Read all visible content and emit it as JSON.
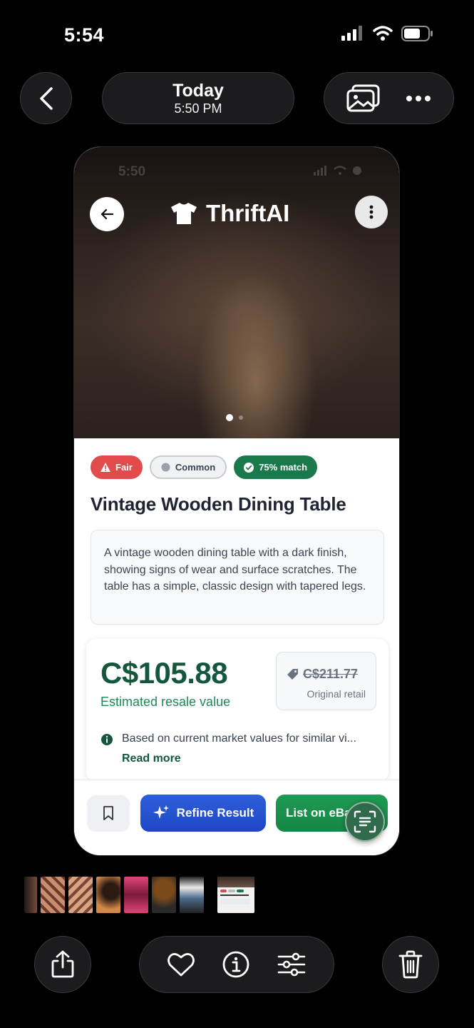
{
  "status_bar": {
    "time": "5:54"
  },
  "photos_header": {
    "date_title": "Today",
    "date_time": "5:50 PM"
  },
  "screenshot": {
    "status_time": "5:50",
    "app_name": "ThriftAI",
    "badges": {
      "condition": "Fair",
      "rarity": "Common",
      "match": "75% match"
    },
    "item_title": "Vintage Wooden Dining Table",
    "description": "A vintage wooden dining table with a dark finish, showing signs of wear and surface scratches. The table has a simple, classic design with tapered legs.",
    "price": "C$105.88",
    "price_label": "Estimated resale value",
    "original_price": "C$211.77",
    "original_label": "Original retail",
    "info_text": "Based on current market values for similar vi...",
    "read_more": "Read more",
    "refine_label": "Refine Result",
    "ebay_label": "List on eBay"
  },
  "colors": {
    "price_green": "#14573c",
    "refine_blue": "#1e46c4",
    "ebay_green": "#178646",
    "fair_red": "#e14b4b",
    "match_green": "#19794a"
  },
  "icons": [
    "back-icon",
    "photo-stack-icon",
    "more-icon",
    "share-icon",
    "heart-icon",
    "info-icon",
    "adjust-icon",
    "trash-icon",
    "bookmark-icon",
    "sparkle-icon",
    "scan-text-icon",
    "tshirt-icon",
    "tag-icon",
    "warning-icon",
    "check-icon"
  ]
}
